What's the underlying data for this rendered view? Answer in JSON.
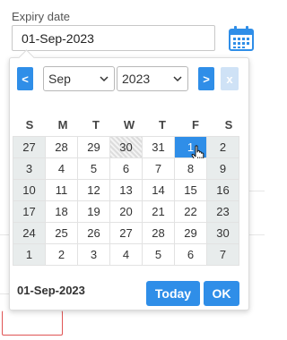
{
  "field": {
    "label": "Expiry date",
    "value": "01-Sep-2023"
  },
  "icons": {
    "calendar": "calendar-icon",
    "chevron": "chevron-down-icon",
    "pointer": "hand-pointer-icon"
  },
  "picker": {
    "prev_label": "<",
    "next_label": ">",
    "clear_label": "x",
    "month": "Sep",
    "year": "2023",
    "weekdays": [
      "S",
      "M",
      "T",
      "W",
      "T",
      "F",
      "S"
    ],
    "weeks": [
      [
        "27",
        "28",
        "29",
        "30",
        "31",
        "1",
        "2"
      ],
      [
        "3",
        "4",
        "5",
        "6",
        "7",
        "8",
        "9"
      ],
      [
        "10",
        "11",
        "12",
        "13",
        "14",
        "15",
        "16"
      ],
      [
        "17",
        "18",
        "19",
        "20",
        "21",
        "22",
        "23"
      ],
      [
        "24",
        "25",
        "26",
        "27",
        "28",
        "29",
        "30"
      ],
      [
        "1",
        "2",
        "3",
        "4",
        "5",
        "6",
        "7"
      ]
    ],
    "selected_date": "01-Sep-2023",
    "today_button": "Today",
    "ok_button": "OK"
  },
  "colors": {
    "accent": "#2f8ee8",
    "weekend_bg": "#e8ecec",
    "clear_disabled": "#cfe2f6"
  }
}
